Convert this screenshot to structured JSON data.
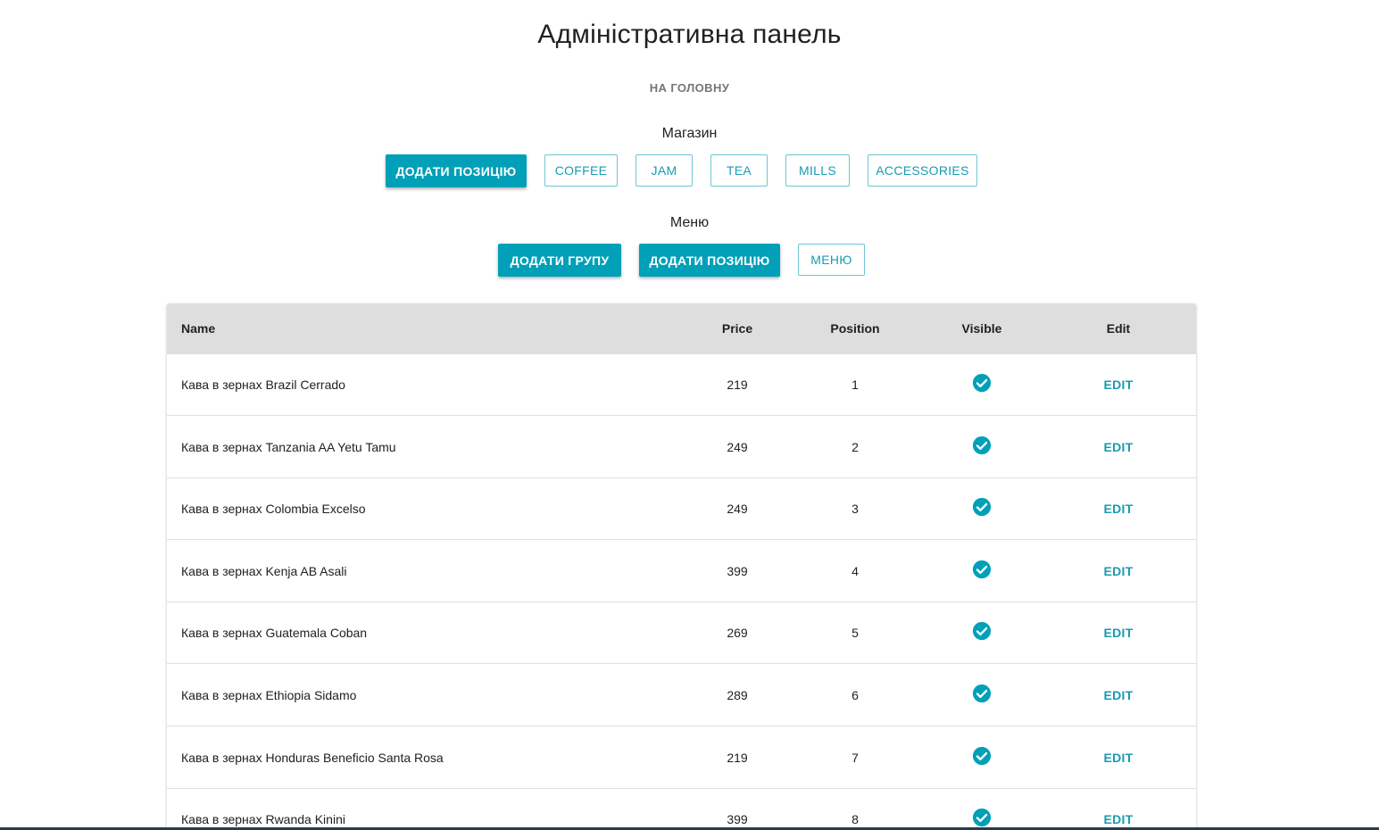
{
  "header": {
    "title": "Адміністративна панель",
    "home_link": "НА ГОЛОВНУ"
  },
  "shop": {
    "label": "Магазин",
    "add_position": "ДОДАТИ ПОЗИЦІЮ",
    "categories": [
      "COFFEE",
      "JAM",
      "TEA",
      "MILLS",
      "ACCESSORIES"
    ]
  },
  "menu": {
    "label": "Меню",
    "add_group": "ДОДАТИ ГРУПУ",
    "add_position": "ДОДАТИ ПОЗИЦІЮ",
    "menu_button": "МЕНЮ"
  },
  "table": {
    "columns": {
      "name": "Name",
      "price": "Price",
      "position": "Position",
      "visible": "Visible",
      "edit": "Edit"
    },
    "edit_label": "EDIT",
    "rows": [
      {
        "name": "Кава в зернах Brazil Cerrado",
        "price": "219",
        "position": "1",
        "visible": true
      },
      {
        "name": "Кава в зернах Tanzania AA Yetu Tamu",
        "price": "249",
        "position": "2",
        "visible": true
      },
      {
        "name": "Кава в зернах Colombia Excelso",
        "price": "249",
        "position": "3",
        "visible": true
      },
      {
        "name": "Кава в зернах Kenja AB Asali",
        "price": "399",
        "position": "4",
        "visible": true
      },
      {
        "name": "Кава в зернах Guatemala Coban",
        "price": "269",
        "position": "5",
        "visible": true
      },
      {
        "name": "Кава в зернах Ethiopia Sidamo",
        "price": "289",
        "position": "6",
        "visible": true
      },
      {
        "name": "Кава в зернах Honduras Beneficio Santa Rosa",
        "price": "219",
        "position": "7",
        "visible": true
      },
      {
        "name": "Кава в зернах Rwanda Kinini",
        "price": "399",
        "position": "8",
        "visible": true
      }
    ]
  },
  "colors": {
    "accent": "#00a0b8",
    "link": "#1a9bb1",
    "header_bg": "#dedede"
  },
  "icons": {
    "visible": "check-circle-icon"
  }
}
